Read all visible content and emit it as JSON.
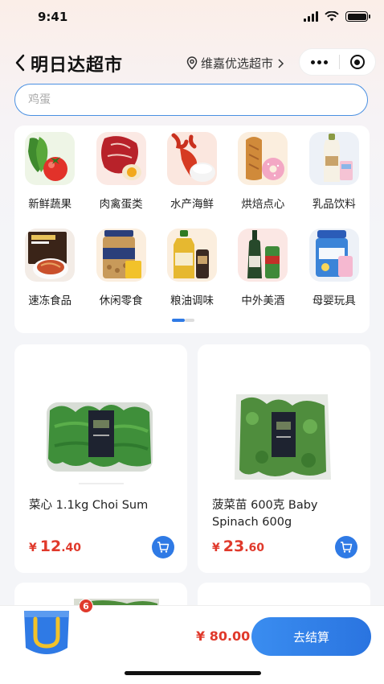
{
  "status": {
    "time": "9:41"
  },
  "nav": {
    "title": "明日达超市",
    "store": "维嘉优选超市"
  },
  "search": {
    "placeholder": "鸡蛋"
  },
  "categories": [
    {
      "label": "新鲜蔬果",
      "icon": "vegetables-icon"
    },
    {
      "label": "肉禽蛋类",
      "icon": "meat-icon"
    },
    {
      "label": "水产海鲜",
      "icon": "lobster-icon"
    },
    {
      "label": "烘焙点心",
      "icon": "bread-icon"
    },
    {
      "label": "乳品饮料",
      "icon": "milk-icon"
    },
    {
      "label": "速冻食品",
      "icon": "frozen-food-icon"
    },
    {
      "label": "休闲零食",
      "icon": "snacks-icon"
    },
    {
      "label": "粮油调味",
      "icon": "oil-icon"
    },
    {
      "label": "中外美酒",
      "icon": "wine-icon"
    },
    {
      "label": "母婴玩具",
      "icon": "baby-formula-icon"
    }
  ],
  "products": [
    {
      "name": "菜心 1.1kg Choi Sum",
      "price_yen": "¥",
      "price_int": "12",
      "price_dec": ".40"
    },
    {
      "name": "菠菜苗 600克 Baby Spinach 600g",
      "price_yen": "¥",
      "price_int": "23",
      "price_dec": ".60"
    }
  ],
  "cart": {
    "count": "6",
    "total": "¥ 80.00",
    "checkout_label": "去结算"
  },
  "colors": {
    "accent": "#2f7ae5",
    "price": "#e0392b"
  }
}
